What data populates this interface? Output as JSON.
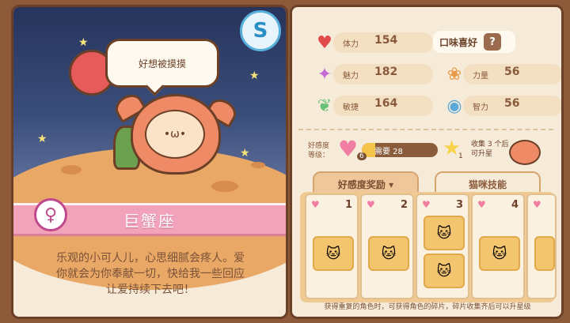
{
  "character": {
    "speech": "好想被摸摸",
    "rank_letter": "S",
    "name": "巨蟹座",
    "description_lines": [
      "乐观的小可人儿，心思细腻会疼人。爱",
      "你就会为你奉献一切，快给我一些回应",
      "让爱持续下去吧！"
    ]
  },
  "stats": [
    {
      "label": "体力",
      "value": "154",
      "icon": "heart-icon"
    },
    {
      "label": "魅力",
      "value": "182",
      "icon": "sparkle-icon"
    },
    {
      "label": "敏捷",
      "value": "164",
      "icon": "wing-icon"
    },
    {
      "label": "力量",
      "value": "56",
      "icon": "paw-icon"
    },
    {
      "label": "智力",
      "value": "56",
      "icon": "lightbulb-icon"
    }
  ],
  "taste": {
    "label": "口味喜好",
    "value": "?"
  },
  "affinity": {
    "label": "好感度等级：",
    "level": "6",
    "need_text": "需要 28",
    "progress": 0.18
  },
  "collect": {
    "count": "1",
    "text": "收集 3 个后可升星"
  },
  "tabs": [
    {
      "label": "好感度奖励 ▾"
    },
    {
      "label": "猫咪技能"
    }
  ],
  "reward_columns": [
    {
      "num": "1"
    },
    {
      "num": "2"
    },
    {
      "num": "3"
    },
    {
      "num": "4"
    }
  ],
  "footer_note": "获得重复的角色时，可获得角色的碎片，碎片收集齐后可以升星级"
}
